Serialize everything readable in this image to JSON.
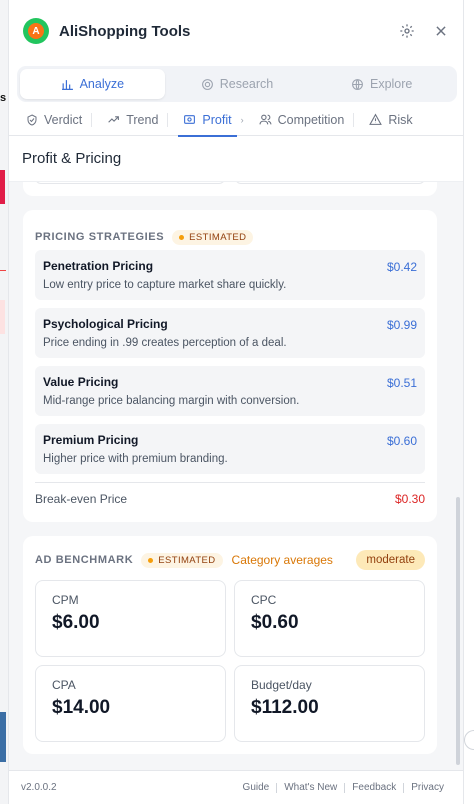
{
  "app": {
    "title": "AliShopping Tools",
    "logo_letter": "A"
  },
  "segments": [
    {
      "label": "Analyze",
      "icon": "bar-chart-icon",
      "active": true
    },
    {
      "label": "Research",
      "icon": "search-icon",
      "active": false
    },
    {
      "label": "Explore",
      "icon": "globe-icon",
      "active": false
    }
  ],
  "tabs": [
    {
      "label": "Verdict",
      "icon": "check-circle-icon"
    },
    {
      "label": "Trend",
      "icon": "trend-icon"
    },
    {
      "label": "Profit",
      "icon": "wallet-icon",
      "active": true
    },
    {
      "label": "Competition",
      "icon": "users-icon"
    },
    {
      "label": "Risk",
      "icon": "warning-icon"
    }
  ],
  "section_title": "Profit & Pricing",
  "pricing": {
    "label": "PRICING STRATEGIES",
    "badge": "ESTIMATED",
    "strategies": [
      {
        "name": "Penetration Pricing",
        "desc": "Low entry price to capture market share quickly.",
        "price": "$0.42"
      },
      {
        "name": "Psychological Pricing",
        "desc": "Price ending in .99 creates perception of a deal.",
        "price": "$0.99"
      },
      {
        "name": "Value Pricing",
        "desc": "Mid-range price balancing margin with conversion.",
        "price": "$0.51"
      },
      {
        "name": "Premium Pricing",
        "desc": "Higher price with premium branding.",
        "price": "$0.60"
      }
    ],
    "breakeven_label": "Break-even Price",
    "breakeven_value": "$0.30"
  },
  "ad": {
    "label": "AD BENCHMARK",
    "badge": "ESTIMATED",
    "subtitle": "Category averages",
    "level": "moderate",
    "metrics": [
      {
        "label": "CPM",
        "value": "$6.00"
      },
      {
        "label": "CPC",
        "value": "$0.60"
      },
      {
        "label": "CPA",
        "value": "$14.00"
      },
      {
        "label": "Budget/day",
        "value": "$112.00"
      }
    ]
  },
  "footer": {
    "version": "v2.0.0.2",
    "links": [
      "Guide",
      "What's New",
      "Feedback",
      "Privacy"
    ]
  },
  "colors": {
    "accent": "#3b6fd6",
    "warning": "#d97706",
    "danger": "#dc2626"
  }
}
